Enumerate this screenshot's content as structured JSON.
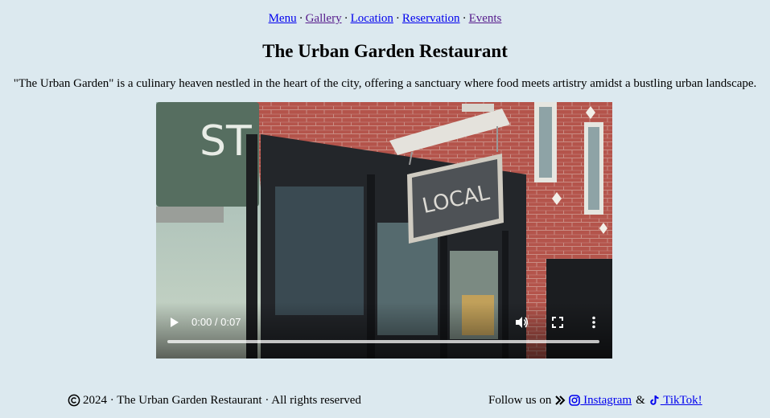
{
  "nav": {
    "items": [
      {
        "label": "Menu",
        "state": "unvisited"
      },
      {
        "label": "Gallery",
        "state": "visited"
      },
      {
        "label": "Location",
        "state": "unvisited"
      },
      {
        "label": "Reservation",
        "state": "unvisited"
      },
      {
        "label": "Events",
        "state": "visited"
      }
    ],
    "separator": "·"
  },
  "header": {
    "title": "The Urban Garden Restaurant"
  },
  "intro": {
    "text": "\"The Urban Garden\" is a culinary heaven nestled in the heart of the city, offering a sanctuary where food meets artistry amidst a bustling urban landscape."
  },
  "video": {
    "time": "0:00 / 0:07",
    "progress": 0,
    "icons": {
      "play": "play-icon",
      "volume": "volume-icon",
      "fullscreen": "fullscreen-icon",
      "more": "more-vertical-icon"
    },
    "scene": {
      "street_sign": "ST",
      "hanging_sign": "LOCAL"
    }
  },
  "footer": {
    "copyright": "2024 · The Urban Garden Restaurant · All rights reserved",
    "follow_label": "Follow us on",
    "instagram_label": " Instagram",
    "and_label": "&",
    "tiktok_label": " TikTok!",
    "icons": {
      "copyright": "copyright-icon",
      "arrow": "double-chevron-right-icon",
      "instagram": "instagram-icon",
      "tiktok": "tiktok-icon"
    }
  }
}
